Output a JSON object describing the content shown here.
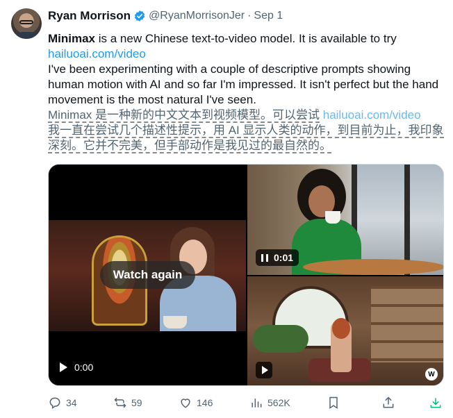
{
  "tweet": {
    "author_name": "Ryan Morrison",
    "handle": "@RyanMorrisonJer",
    "separator": "·",
    "date": "Sep 1",
    "text_bold": "Minimax",
    "text_line1_rest": " is a new Chinese text-to-video model. It is available to try",
    "link": "hailuoai.com/video",
    "text_para2": "I've been experimenting with a couple of descriptive prompts showing human motion with AI and so far I'm impressed. It isn't perfect but the hand movement is the most natural I've seen.",
    "translation_line1": "Minimax 是一种新的中文文本到视频模型。可以尝试",
    "translation_link": "hailuoai.com/video",
    "translation_line2": "我一直在尝试几个描述性提示，用 AI 显示人类的动作，到目前为止，我印象深刻。它并不完美，但手部动作是我见过的最自然的。"
  },
  "media": {
    "left_video": {
      "overlay_label": "Watch again",
      "time": "0:00"
    },
    "top_right_video": {
      "time": "0:01"
    },
    "bottom_right_video": {
      "watermark": "W"
    }
  },
  "actions": {
    "replies": "34",
    "reposts": "59",
    "likes": "146",
    "views": "562K"
  },
  "colors": {
    "link": "#1d9bf0",
    "verified": "#1d9bf0",
    "muted_text": "#536471",
    "download_icon": "#00ba7c"
  },
  "icons": [
    "verified-badge-icon",
    "reply-icon",
    "repost-icon",
    "like-icon",
    "views-icon",
    "bookmark-icon",
    "share-icon",
    "download-icon",
    "play-icon",
    "pause-icon"
  ]
}
